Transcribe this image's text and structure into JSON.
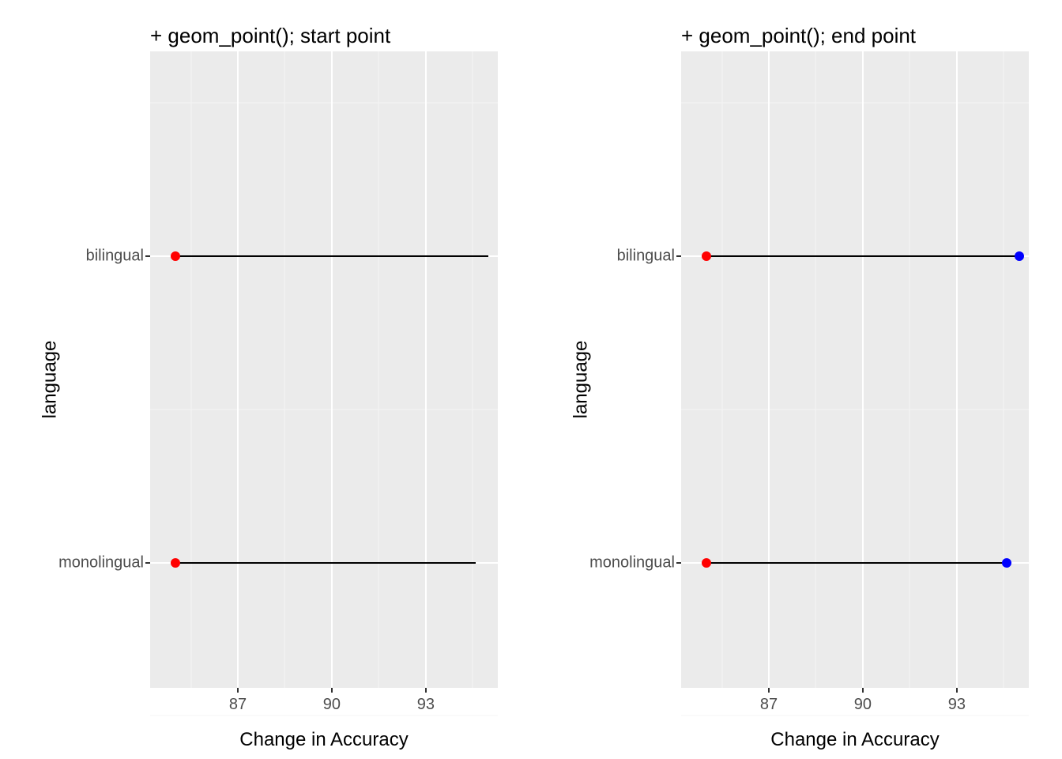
{
  "chart_data": [
    {
      "type": "line",
      "title": "+ geom_point(); start point",
      "xlabel": "Change in Accuracy",
      "ylabel": "language",
      "xlim": [
        84.2,
        95.3
      ],
      "x_ticks": [
        87,
        90,
        93
      ],
      "x_minor": [
        85.5,
        88.5,
        91.5,
        94.5
      ],
      "categories": [
        "bilingual",
        "monolingual"
      ],
      "y_minor": [
        0,
        1.5,
        3
      ],
      "series": [
        {
          "name": "bilingual",
          "segment": {
            "x0": 85.0,
            "x1": 95.0
          },
          "points": [
            {
              "x": 85.0,
              "color": "#ff0000"
            }
          ]
        },
        {
          "name": "monolingual",
          "segment": {
            "x0": 85.0,
            "x1": 94.6
          },
          "points": [
            {
              "x": 85.0,
              "color": "#ff0000"
            }
          ]
        }
      ]
    },
    {
      "type": "line",
      "title": "+ geom_point(); end point",
      "xlabel": "Change in Accuracy",
      "ylabel": "language",
      "xlim": [
        84.2,
        95.3
      ],
      "x_ticks": [
        87,
        90,
        93
      ],
      "x_minor": [
        85.5,
        88.5,
        91.5,
        94.5
      ],
      "categories": [
        "bilingual",
        "monolingual"
      ],
      "y_minor": [
        0,
        1.5,
        3
      ],
      "series": [
        {
          "name": "bilingual",
          "segment": {
            "x0": 85.0,
            "x1": 95.0
          },
          "points": [
            {
              "x": 85.0,
              "color": "#ff0000"
            },
            {
              "x": 95.0,
              "color": "#0000ff"
            }
          ]
        },
        {
          "name": "monolingual",
          "segment": {
            "x0": 85.0,
            "x1": 94.6
          },
          "points": [
            {
              "x": 85.0,
              "color": "#ff0000"
            },
            {
              "x": 94.6,
              "color": "#0000ff"
            }
          ]
        }
      ]
    }
  ]
}
